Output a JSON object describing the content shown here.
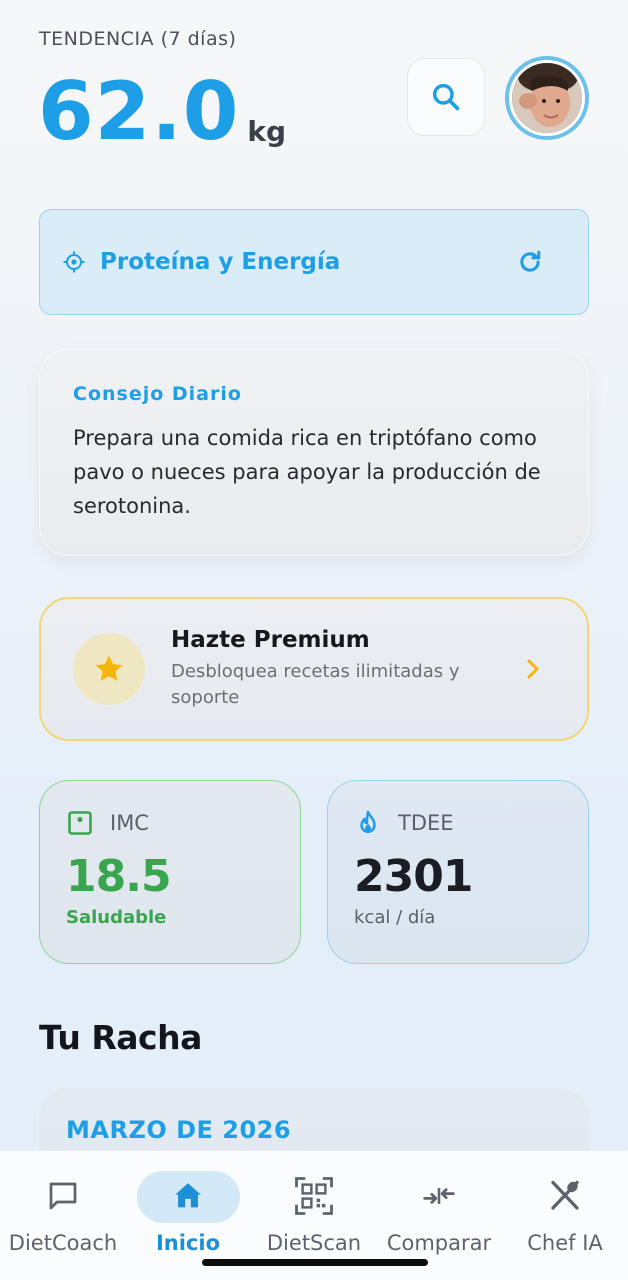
{
  "header": {
    "trend_label": "TENDENCIA (7 días)",
    "weight_value": "62.0",
    "weight_unit": "kg"
  },
  "goal": {
    "label": "Proteína y Energía"
  },
  "tip": {
    "title": "Consejo Diario",
    "text": "Prepara una comida rica en triptófano como pavo o nueces para apoyar la producción de serotonina."
  },
  "premium": {
    "title": "Hazte Premium",
    "subtitle": "Desbloquea recetas ilimitadas y soporte"
  },
  "stats": {
    "imc": {
      "label": "IMC",
      "value": "18.5",
      "sub": "Saludable"
    },
    "tdee": {
      "label": "TDEE",
      "value": "2301",
      "sub": "kcal / día"
    }
  },
  "streak": {
    "title": "Tu Racha",
    "month": "MARZO DE 2026"
  },
  "nav": {
    "items": [
      {
        "label": "DietCoach",
        "icon": "chat-icon"
      },
      {
        "label": "Inicio",
        "icon": "home-icon",
        "active": true
      },
      {
        "label": "DietScan",
        "icon": "qr-scan-icon"
      },
      {
        "label": "Comparar",
        "icon": "compare-icon"
      },
      {
        "label": "Chef IA",
        "icon": "utensils-icon"
      }
    ]
  },
  "colors": {
    "accent": "#1d9ee6",
    "healthy": "#3aa54f",
    "premium_border": "#f2d774",
    "star": "#f5b50a"
  }
}
